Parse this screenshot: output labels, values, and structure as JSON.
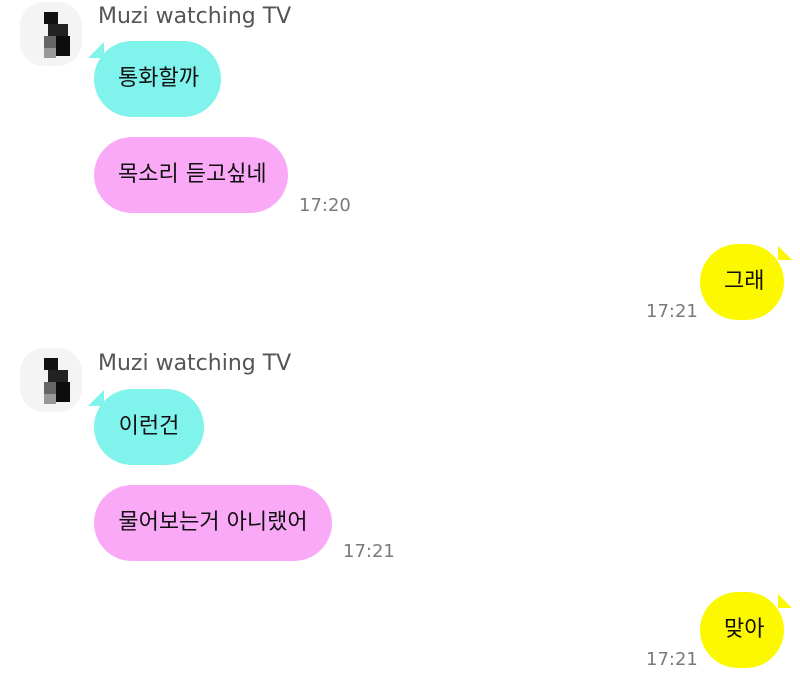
{
  "colors": {
    "incoming_first": "#7ff3ec",
    "incoming_second": "#f9a9f6",
    "outgoing": "#fbf800",
    "timestamp": "#7a7a7a"
  },
  "messages": {
    "group1": {
      "sender": "Muzi watching TV",
      "bubble1": "통화할까",
      "bubble2": "목소리 듣고싶네",
      "time": "17:20"
    },
    "reply1": {
      "text": "그래",
      "time": "17:21"
    },
    "group2": {
      "sender": "Muzi watching TV",
      "bubble1": "이런건",
      "bubble2": "물어보는거 아니랬어",
      "time": "17:21"
    },
    "reply2": {
      "text": "맞아",
      "time": "17:21"
    }
  }
}
